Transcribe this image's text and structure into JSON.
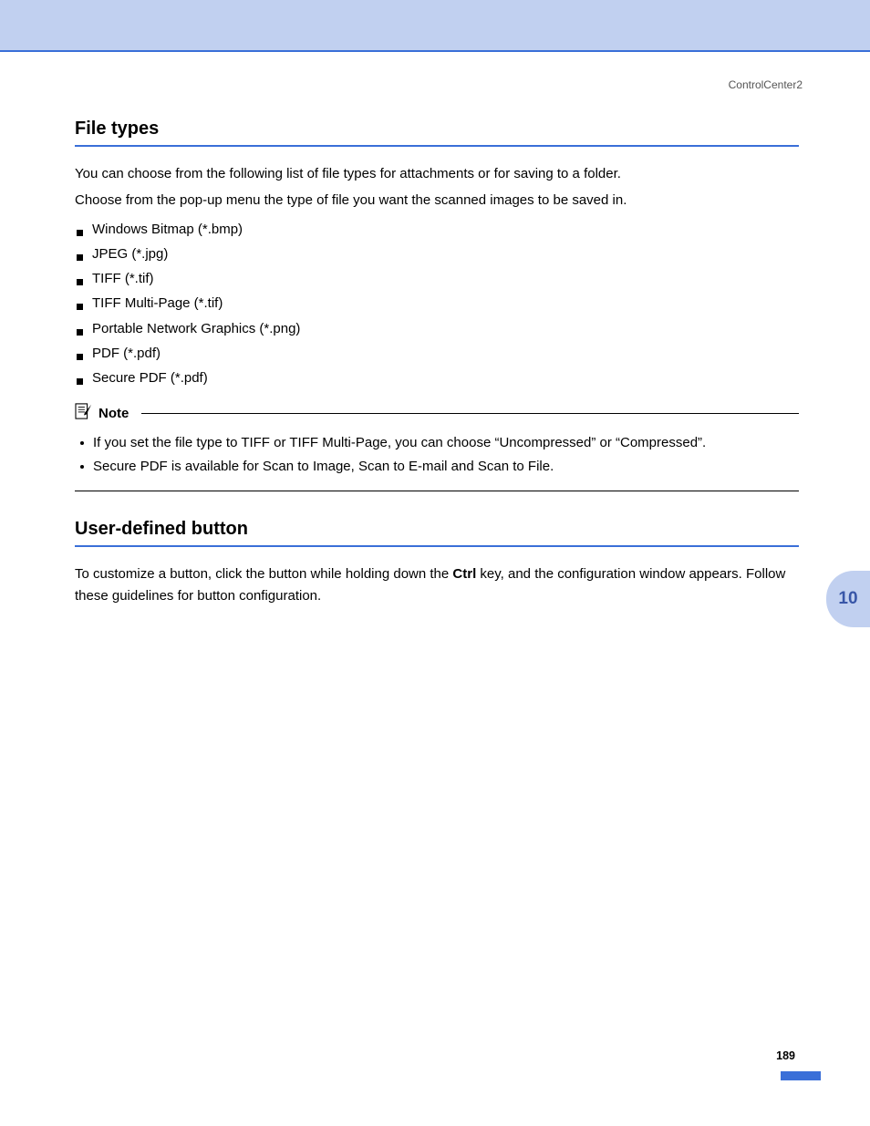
{
  "header": {
    "right_label": "ControlCenter2"
  },
  "section_filetypes": {
    "heading": "File types",
    "para1": "You can choose from the following list of file types for attachments or for saving to a folder.",
    "para2": "Choose from the pop-up menu the type of file you want the scanned images to be saved in.",
    "items": [
      "Windows Bitmap (*.bmp)",
      "JPEG (*.jpg)",
      "TIFF (*.tif)",
      "TIFF Multi-Page (*.tif)",
      "Portable Network Graphics (*.png)",
      "PDF (*.pdf)",
      "Secure PDF (*.pdf)"
    ],
    "note": {
      "title": "Note",
      "items": [
        "If you set the file type to TIFF or TIFF Multi-Page, you can choose “Uncompressed” or “Compressed”.",
        "Secure PDF is available for Scan to Image, Scan to E-mail and Scan to File."
      ]
    }
  },
  "section_userdefined": {
    "heading": "User-defined button",
    "para_parts": {
      "before": "To customize a button, click the button while holding down the ",
      "bold": "Ctrl",
      "after": " key, and the configuration window appears. Follow these guidelines for button configuration."
    }
  },
  "side_tab": "10",
  "page_number": "189"
}
